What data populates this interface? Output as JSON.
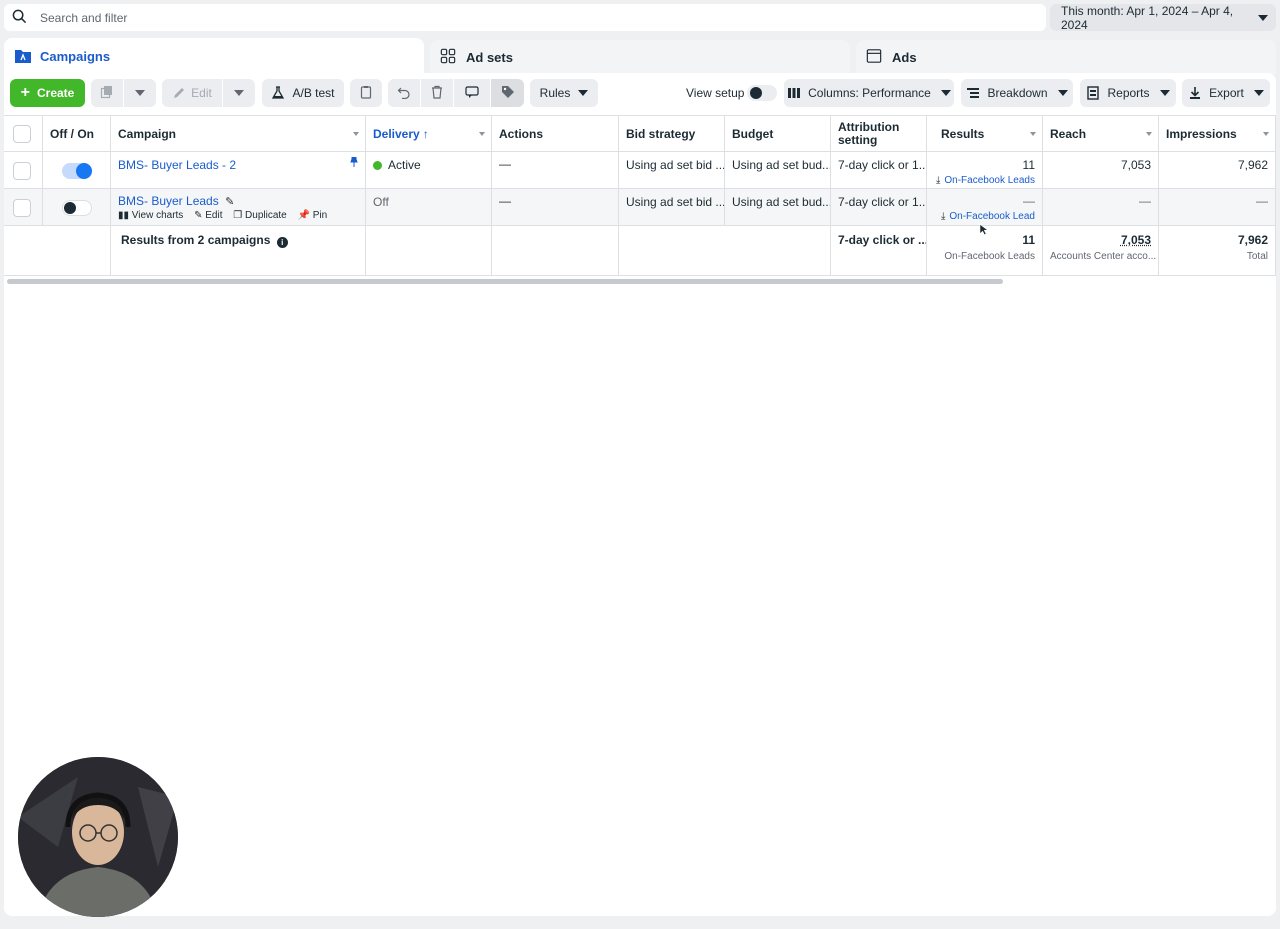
{
  "search": {
    "placeholder": "Search and filter"
  },
  "date_range": "This month: Apr 1, 2024 – Apr 4, 2024",
  "tabs": [
    {
      "label": "Campaigns"
    },
    {
      "label": "Ad sets"
    },
    {
      "label": "Ads"
    }
  ],
  "toolbar": {
    "create": "Create",
    "edit": "Edit",
    "ab_test": "A/B test",
    "rules": "Rules",
    "view_setup": "View setup",
    "columns": "Columns: Performance",
    "breakdown": "Breakdown",
    "reports": "Reports",
    "export": "Export"
  },
  "columns": {
    "off_on": "Off / On",
    "campaign": "Campaign",
    "delivery": "Delivery",
    "actions": "Actions",
    "bid_strategy": "Bid strategy",
    "budget": "Budget",
    "attribution": "Attribution setting",
    "results": "Results",
    "reach": "Reach",
    "impressions": "Impressions"
  },
  "rows": [
    {
      "campaign": "BMS- Buyer Leads - 2",
      "toggle_on": true,
      "delivery": "Active",
      "actions": "—",
      "bid_strategy": "Using ad set bid ...",
      "budget": "Using ad set bud...",
      "attribution": "7-day click or 1...",
      "results": "11",
      "results_sub": "On-Facebook Leads",
      "reach": "7,053",
      "impressions": "7,962"
    },
    {
      "campaign": "BMS- Buyer Leads",
      "toggle_on": false,
      "delivery": "Off",
      "actions": "—",
      "bid_strategy": "Using ad set bid ...",
      "budget": "Using ad set bud...",
      "attribution": "7-day click or 1...",
      "results": "—",
      "results_sub": "On-Facebook Lead",
      "reach": "—",
      "impressions": "—",
      "hover_actions": [
        "View charts",
        "Edit",
        "Duplicate",
        "Pin"
      ]
    }
  ],
  "summary": {
    "label": "Results from 2 campaigns",
    "attribution": "7-day click or ...",
    "results": "11",
    "results_sub": "On-Facebook Leads",
    "reach": "7,053",
    "reach_sub": "Accounts Center acco...",
    "impressions": "7,962",
    "impressions_sub": "Total"
  }
}
